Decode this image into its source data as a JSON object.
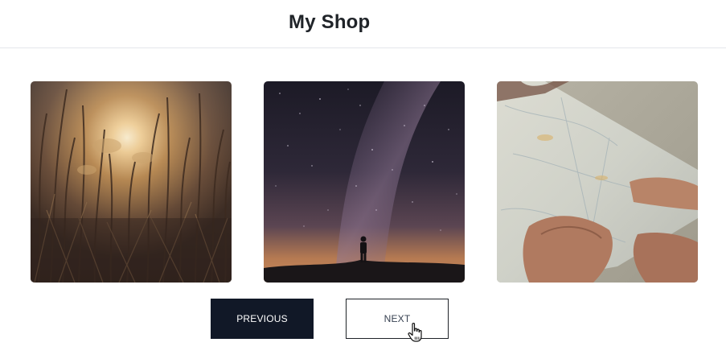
{
  "header": {
    "title": "My Shop"
  },
  "gallery": {
    "images": [
      {
        "icon": "reeds-sunset-photo"
      },
      {
        "icon": "milky-way-silhouette-photo"
      },
      {
        "icon": "hands-holding-map-photo"
      }
    ]
  },
  "pagination": {
    "previous_label": "PREVIOUS",
    "next_label": "NEXT"
  },
  "colors": {
    "primary_button_bg": "#111827",
    "primary_button_text": "#ffffff",
    "secondary_button_border": "#1f2328",
    "header_divider": "#e5e7eb"
  },
  "cursor": {
    "icon": "hand-pointer-icon"
  }
}
